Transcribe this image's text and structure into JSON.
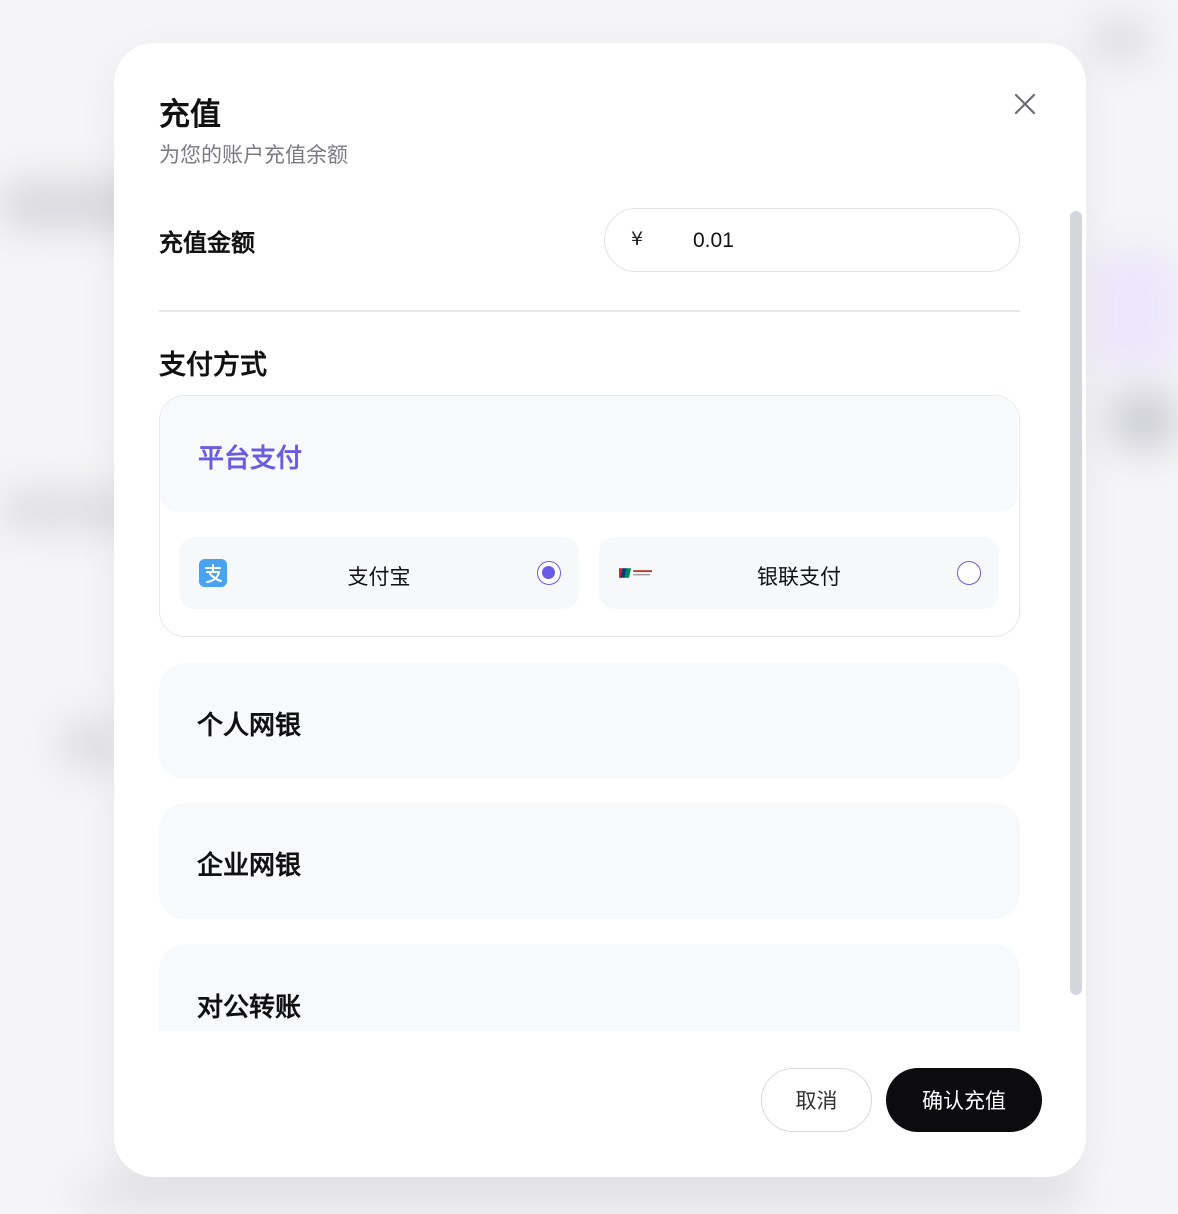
{
  "dialog": {
    "title": "充值",
    "subtitle": "为您的账户充值余额"
  },
  "amount": {
    "label": "充值金额",
    "currency_symbol": "¥",
    "value": "0.01"
  },
  "payment": {
    "title": "支付方式",
    "groups": [
      {
        "label": "平台支付",
        "expanded": true,
        "options": [
          {
            "label": "支付宝",
            "icon": "alipay-icon",
            "selected": true
          },
          {
            "label": "银联支付",
            "icon": "unionpay-icon",
            "selected": false
          }
        ]
      },
      {
        "label": "个人网银",
        "expanded": false
      },
      {
        "label": "企业网银",
        "expanded": false
      },
      {
        "label": "对公转账",
        "expanded": false
      }
    ]
  },
  "actions": {
    "cancel_label": "取消",
    "confirm_label": "确认充值"
  },
  "colors": {
    "accent": "#6a5ce0",
    "primary_button": "#0c0c0e",
    "panel_bg": "#f8f9fb"
  }
}
